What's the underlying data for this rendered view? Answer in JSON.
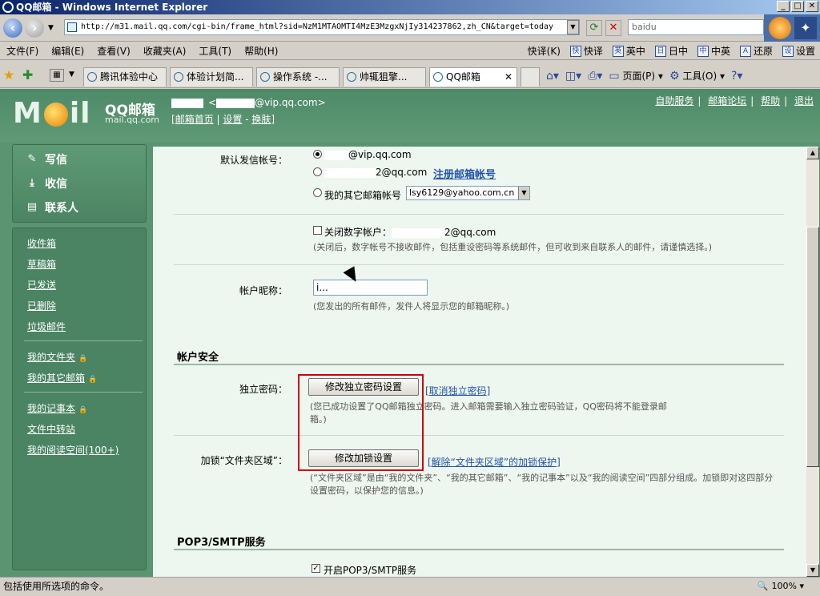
{
  "window": {
    "title": "QQ邮箱 - Windows Internet Explorer",
    "min": "_",
    "max": "□",
    "close": "✕"
  },
  "address_bar": {
    "url": "http://m31.mail.qq.com/cgi-bin/frame_html?sid=NzM1MTAOMTI4MzE3MzgxNjIy314237862,zh_CN&target=today",
    "search_value": "baidu"
  },
  "menu": {
    "items": [
      "文件(F)",
      "编辑(E)",
      "查看(V)",
      "收藏夹(A)",
      "工具(T)",
      "帮助(H)"
    ],
    "tools": [
      {
        "icon": "快",
        "label": "快译(K)"
      },
      {
        "icon": "快",
        "label": "快译"
      },
      {
        "icon": "英",
        "label": "英中"
      },
      {
        "icon": "日",
        "label": "日中"
      },
      {
        "icon": "中",
        "label": "中英"
      },
      {
        "icon": "A",
        "label": "还原"
      },
      {
        "icon": "设",
        "label": "设置"
      }
    ]
  },
  "tabs": [
    {
      "label": "腾讯体验中心"
    },
    {
      "label": "体验计划简..."
    },
    {
      "label": "操作系统 -..."
    },
    {
      "label": "帅辄狙擎..."
    },
    {
      "label": "QQ邮箱"
    }
  ],
  "tab_close": "✕",
  "command_bar": {
    "page_label": "页面(P)",
    "tools_label": "工具(O)"
  },
  "header": {
    "logo_text": "M  il",
    "brand_title": "QQ邮箱",
    "brand_sub": "mail.qq.com",
    "email_suffix": "@vip.qq.com>",
    "email_prefix": "<",
    "links": {
      "home": "邮箱首页",
      "settings": "设置",
      "skin": "换肤"
    },
    "top_links": [
      "自助服务",
      "邮箱论坛",
      "帮助",
      "退出"
    ]
  },
  "nav": {
    "actions": [
      {
        "icon": "write-icon",
        "label": "写信"
      },
      {
        "icon": "inbox-download-icon",
        "label": "收信"
      },
      {
        "icon": "contacts-icon",
        "label": "联系人"
      }
    ],
    "folders_group1": [
      "收件箱",
      "草稿箱",
      "已发送",
      "已删除",
      "垃圾邮件"
    ],
    "folders_group2": [
      "我的文件夹",
      "我的其它邮箱"
    ],
    "folders_group3": [
      "我的记事本",
      "文件中转站",
      "我的阅读空间(100+)"
    ]
  },
  "settings": {
    "default_sender_label": "默认发信帐号：",
    "sender_vip": "@vip.qq.com",
    "sender_qq": "2@qq.com",
    "register_link": "注册邮箱帐号",
    "other_mailbox_label": "我的其它邮箱帐号",
    "other_mailbox_value": "lsy6129@yahoo.com.cn",
    "close_digital_label": "关闭数字帐户：",
    "close_digital_suffix": "2@qq.com",
    "close_digital_hint": "(关闭后，数字帐号不接收邮件，包括重设密码等系统邮件，但可收到来自联系人的邮件，请谨慎选择。)",
    "nickname_label": "帐户昵称：",
    "nickname_value": "i...",
    "nickname_hint": "(您发出的所有邮件，发件人将显示您的邮箱昵称。)",
    "security_title": "帐户安全",
    "password_label": "独立密码：",
    "password_button": "修改独立密码设置",
    "password_cancel_link": "[取消独立密码]",
    "password_hint": "(您已成功设置了QQ邮箱独立密码。进入邮箱需要输入独立密码验证，QQ密码将不能登录邮箱。)",
    "lock_label": "加锁“文件夹区域”：",
    "lock_button": "修改加锁设置",
    "lock_cancel_link": "[解除“文件夹区域”的加锁保护]",
    "lock_hint": "(“文件夹区域”是由“我的文件夹”、“我的其它邮箱”、“我的记事本”以及“我的阅读空间”四部分组成。加锁即对这四部分设置密码，以保护您的信息。)",
    "pop3_title": "POP3/SMTP服务",
    "pop3_checkbox": "开启POP3/SMTP服务"
  },
  "status": {
    "text": "包括使用所选项的命令。",
    "zoom": "100%"
  }
}
